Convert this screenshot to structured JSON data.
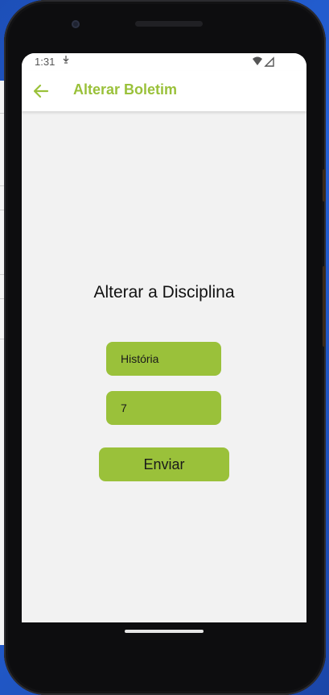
{
  "status_bar": {
    "time": "1:31",
    "icons": [
      "notification-icon",
      "wifi-icon",
      "signal-icon"
    ]
  },
  "app_bar": {
    "title": "Alterar Boletim",
    "back_icon": "arrow-left-icon"
  },
  "form": {
    "heading": "Alterar a Disciplina",
    "subject_value": "História",
    "grade_value": "7",
    "submit_label": "Enviar"
  },
  "colors": {
    "accent": "#9ac13a",
    "background": "#f2f2f2",
    "app_bar": "#ffffff"
  }
}
